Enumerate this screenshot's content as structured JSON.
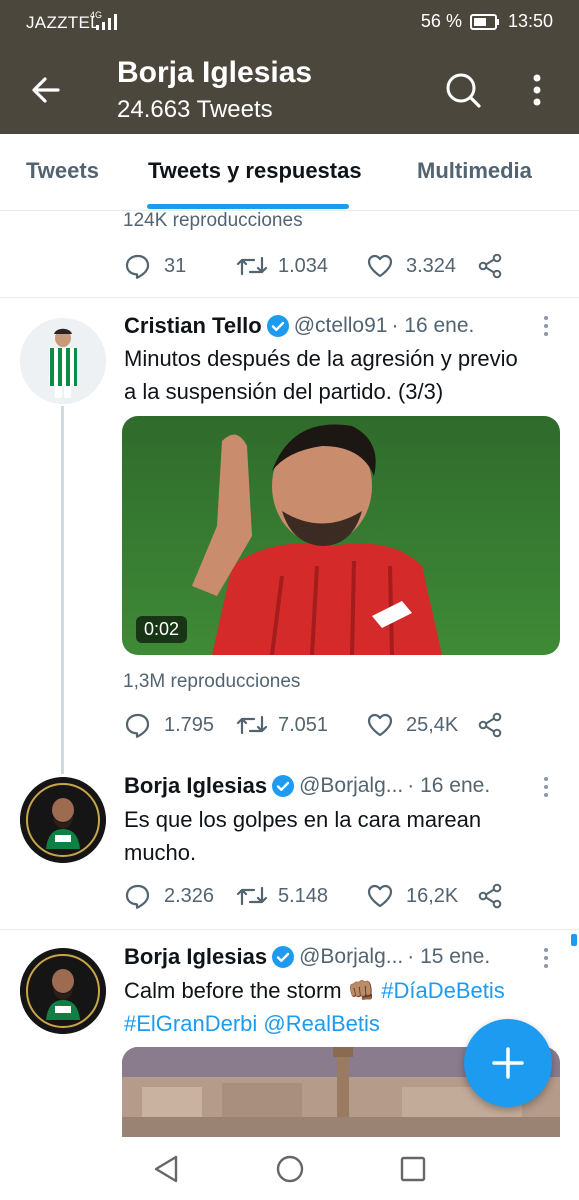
{
  "status_bar": {
    "carrier": "JAZZTEL",
    "network": "4G",
    "battery": "56 %",
    "time": "13:50"
  },
  "header": {
    "title": "Borja Iglesias",
    "subtitle": "24.663 Tweets"
  },
  "tabs": [
    {
      "label": "Tweets",
      "active": false
    },
    {
      "label": "Tweets y respuestas",
      "active": true
    },
    {
      "label": "Multimedia",
      "active": false
    }
  ],
  "tweet0": {
    "views": "124K reproducciones",
    "replies": "31",
    "retweets": "1.034",
    "likes": "3.324"
  },
  "tweet1": {
    "name": "Cristian Tello",
    "handle": "@ctello91",
    "date": "· 16 ene.",
    "text_line1": "Minutos después de la agresión y previo",
    "text_line2": "a la suspensión del partido. (3/3)",
    "video_duration": "0:02",
    "views": "1,3M reproducciones",
    "replies": "1.795",
    "retweets": "7.051",
    "likes": "25,4K"
  },
  "tweet2": {
    "name": "Borja Iglesias",
    "handle": "@Borjalg...",
    "date": "· 16 ene.",
    "text_line1": "Es que los golpes en la cara marean",
    "text_line2": "mucho.",
    "replies": "2.326",
    "retweets": "5.148",
    "likes": "16,2K"
  },
  "tweet3": {
    "name": "Borja Iglesias",
    "handle": "@Borjalg...",
    "date": "· 15 ene.",
    "text_line1_plain": "Calm before the storm 👊🏽",
    "text_line1_hashtag": "#DíaDeBetis",
    "text_line2_hashtag": "#ElGranDerbi",
    "text_line2_mention": "@RealBetis"
  },
  "colors": {
    "header_bg": "#4c473d",
    "accent": "#1d9bf0",
    "secondary_text": "#536471"
  }
}
